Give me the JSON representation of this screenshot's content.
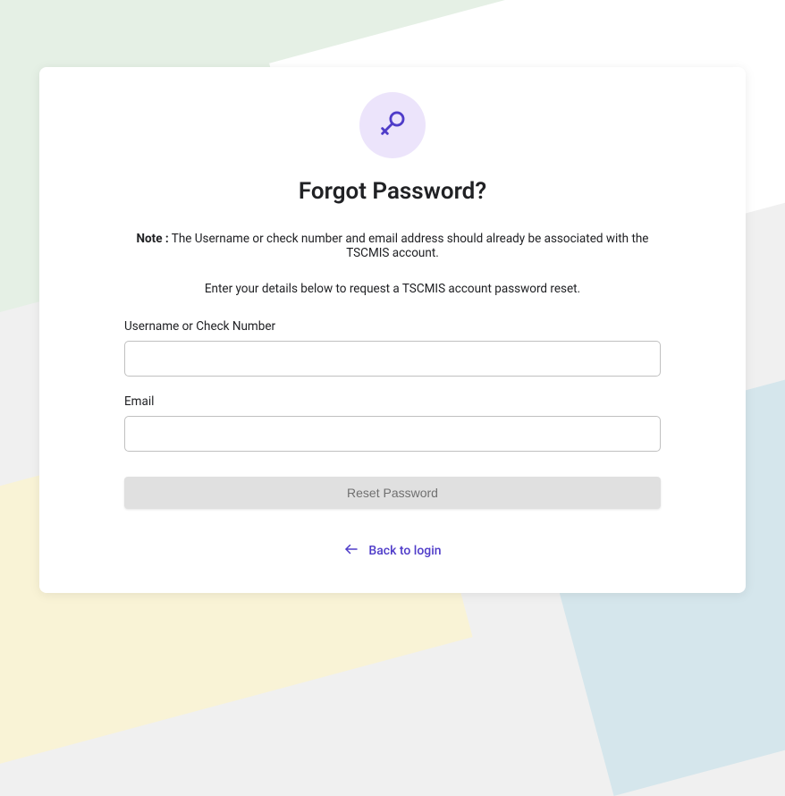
{
  "icon": "key-icon",
  "title": "Forgot Password?",
  "note_label": "Note :",
  "note_text": " The Username or check number and email address should already be associated with the TSCMIS account.",
  "instructions": "Enter your details below to request a TSCMIS account password reset.",
  "fields": {
    "username": {
      "label": "Username or Check Number",
      "value": ""
    },
    "email": {
      "label": "Email",
      "value": ""
    }
  },
  "reset_button": "Reset Password",
  "back_link": "Back to login",
  "colors": {
    "accent": "#4f3cc9",
    "icon_bg": "#ece4fb"
  }
}
